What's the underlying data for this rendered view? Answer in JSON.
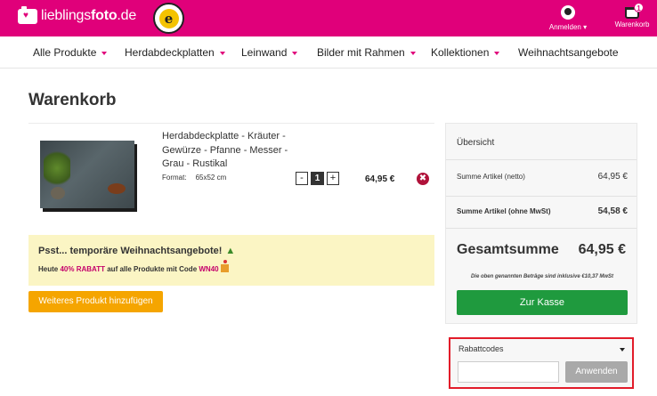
{
  "header": {
    "logo_text_light": "lieblings",
    "logo_text_bold": "foto",
    "logo_text_tld": ".de",
    "trust_badge_letter": "e",
    "account_label": "Anmelden",
    "cart_label": "Warenkorb",
    "cart_count": "1",
    "brand_color": "#e0007a"
  },
  "nav": {
    "items": [
      {
        "label": "Alle Produkte",
        "has_dropdown": true
      },
      {
        "label": "Herdabdeckplatten",
        "has_dropdown": true
      },
      {
        "label": "Leinwand",
        "has_dropdown": true
      },
      {
        "label": "Bilder mit Rahmen",
        "has_dropdown": true
      },
      {
        "label": "Kollektionen",
        "has_dropdown": true
      },
      {
        "label": "Weihnachtsangebote",
        "has_dropdown": false
      }
    ]
  },
  "page": {
    "title": "Warenkorb"
  },
  "cart_item": {
    "title": "Herdabdeckplatte - Kräuter - Gewürze - Pfanne - Messer - Grau - Rustikal",
    "format_label": "Format:",
    "format_value": "65x52 cm",
    "quantity_minus": "-",
    "quantity": "1",
    "quantity_plus": "+",
    "price": "64,95 €",
    "remove_symbol": "✖"
  },
  "promo": {
    "title": "Psst... temporäre Weihnachtsangebote!",
    "line_prefix": "Heute",
    "discount": "40% RABATT",
    "line_middle": "auf alle Produkte mit Code",
    "code": "WN40"
  },
  "add_product_label": "Weiteres Produkt hinzufügen",
  "summary": {
    "title": "Übersicht",
    "net_label": "Summe Artikel (netto)",
    "net_amount": "64,95 €",
    "no_vat_label": "Summe Artikel (ohne MwSt)",
    "no_vat_amount": "54,58 €",
    "total_label": "Gesamtsumme",
    "total_amount": "64,95 €",
    "tax_note": "Die oben genannten Beträge sind inklusive €10,37 MwSt",
    "checkout_label": "Zur Kasse",
    "checkout_color": "#1f9a3e"
  },
  "coupon": {
    "title": "Rabattcodes",
    "input_value": "",
    "apply_label": "Anwenden",
    "highlight_color": "#e21c2a"
  }
}
